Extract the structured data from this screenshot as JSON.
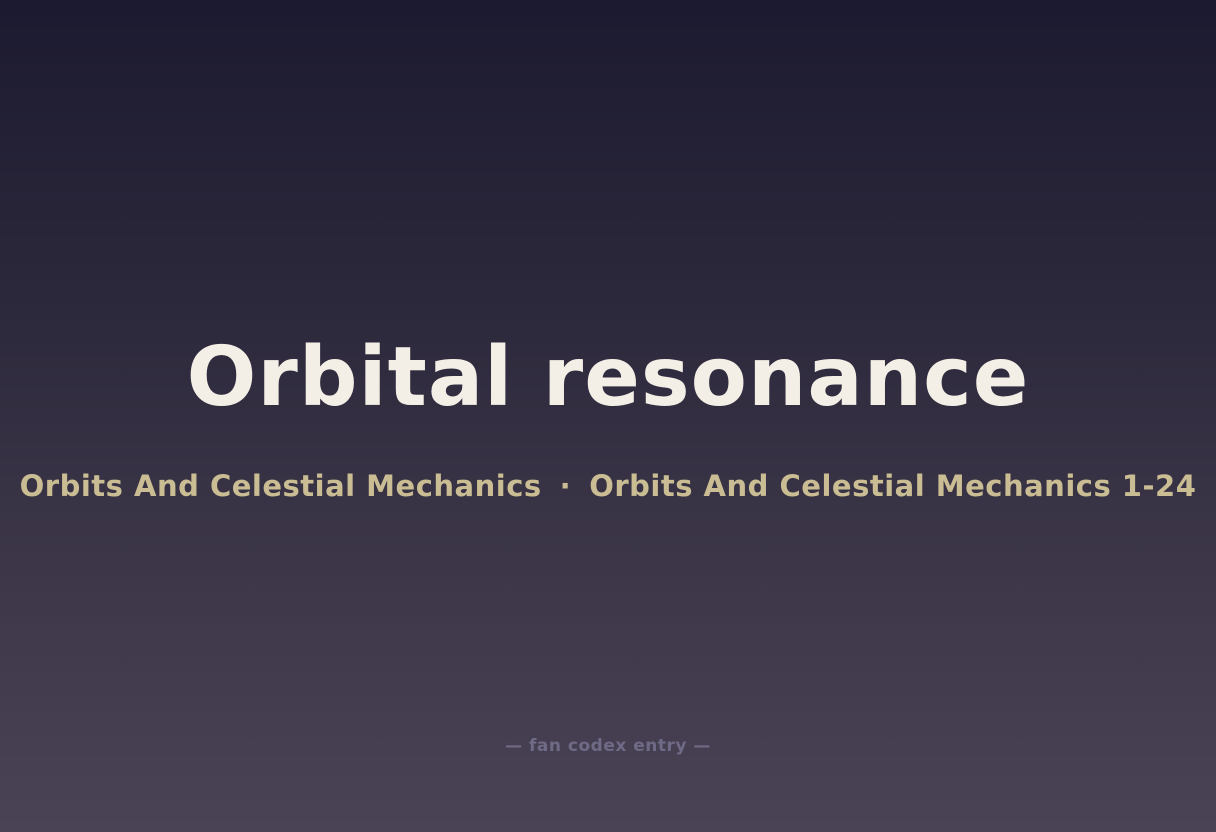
{
  "title": "Orbital resonance",
  "subtitle": {
    "category": "Orbits And Celestial Mechanics",
    "separator": "·",
    "series": "Orbits And Celestial Mechanics 1-24"
  },
  "footer": "— fan codex entry —",
  "colors": {
    "title": "#f4efe6",
    "subtitle": "#cbbd93",
    "footer": "#6f6a85",
    "background_top": "#1c1a30",
    "background_bottom": "#4a4356"
  }
}
